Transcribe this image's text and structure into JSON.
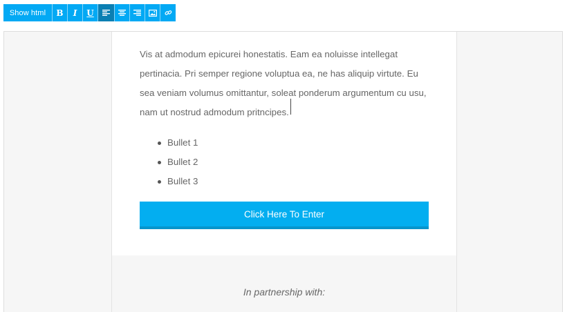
{
  "toolbar": {
    "show_html_label": "Show html",
    "bold_label": "B",
    "italic_label": "I",
    "underline_label": "U",
    "buttons": [
      "bold-icon",
      "italic-icon",
      "underline-icon",
      "align-left-icon",
      "align-center-icon",
      "align-right-icon",
      "image-icon",
      "link-icon"
    ],
    "active": "align-left"
  },
  "content": {
    "paragraph": "Vis at admodum epicurei honestatis. Eam ea noluisse intellegat pertinacia. Pri semper regione voluptua ea, ne has aliquip virtute. Eu sea veniam volumus omittantur, soleat ponderum argumentum cu usu, nam ut nostrud admodum pritncipes.",
    "bullets": [
      "Bullet 1",
      "Bullet 2",
      "Bullet 3"
    ],
    "cta_label": "Click Here To Enter"
  },
  "footer": {
    "partner_text": "In partnership with:"
  },
  "colors": {
    "accent": "#03a9f4",
    "active": "#0b7fb3",
    "cta": "#03aef0"
  }
}
